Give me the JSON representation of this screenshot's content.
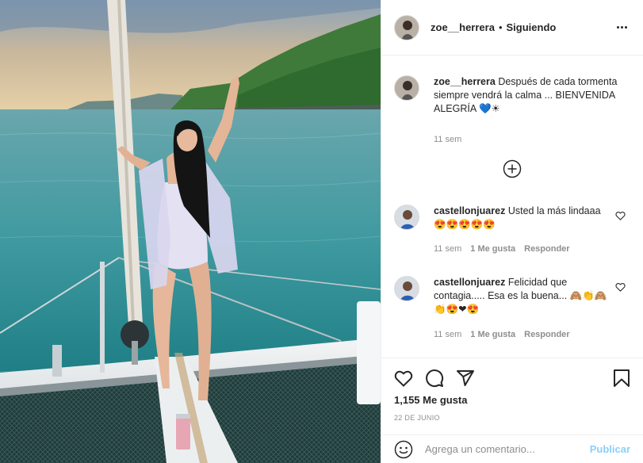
{
  "post": {
    "author": "zoe__herrera",
    "separator": "•",
    "follow_status": "Siguiendo",
    "image_alt": "Foto de zoe__herrera en un catamarán"
  },
  "caption": {
    "username": "zoe__herrera",
    "text": "Después de cada tormenta siempre vendrá la calma ... BIENVENIDA ALEGRÍA 💙☀",
    "time": "11 sem"
  },
  "comments": [
    {
      "username": "castellonjuarez",
      "text": "Usted la más lindaaa😍😍😍😍😍",
      "time": "11 sem",
      "likes": "1 Me gusta",
      "reply": "Responder"
    },
    {
      "username": "castellonjuarez",
      "text": "Felicidad que contagia..... Esa es la buena... 🙈👏🙈👏😍❤😍",
      "time": "11 sem",
      "likes": "1 Me gusta",
      "reply": "Responder"
    }
  ],
  "actions": {
    "likes": "1,155 Me gusta",
    "date": "22 DE JUNIO"
  },
  "composer": {
    "placeholder": "Agrega un comentario...",
    "publish_label": "Publicar"
  },
  "colors": {
    "text": "#262626",
    "muted": "#8e8e8e",
    "link_blue": "#0095f6",
    "border": "#efefef"
  }
}
